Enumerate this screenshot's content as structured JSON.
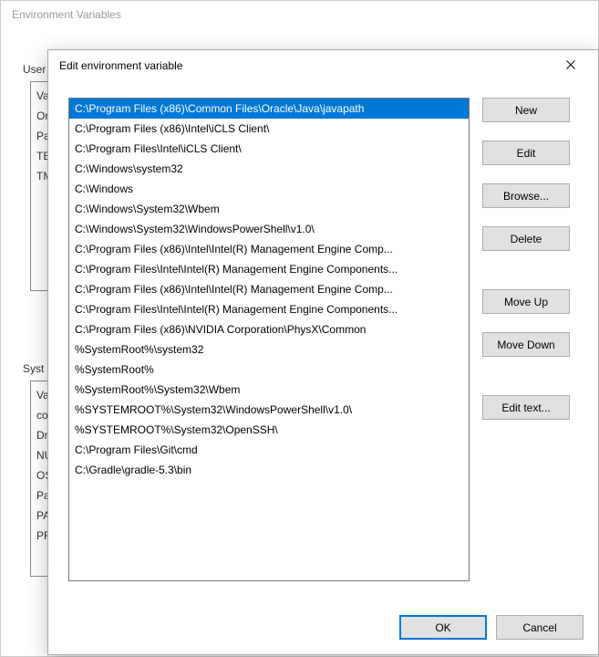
{
  "bg": {
    "title": "Environment Variables",
    "user_label": "User",
    "user_rows": [
      "Va",
      "On",
      "Pa",
      "TE",
      "TM"
    ],
    "sys_label": "Syst",
    "sys_rows": [
      "Va",
      "co",
      "Dr",
      "NU",
      "OS",
      "Pa",
      "PA",
      "PR"
    ]
  },
  "dialog": {
    "title": "Edit environment variable",
    "list": [
      "C:\\Program Files (x86)\\Common Files\\Oracle\\Java\\javapath",
      "C:\\Program Files (x86)\\Intel\\iCLS Client\\",
      "C:\\Program Files\\Intel\\iCLS Client\\",
      "C:\\Windows\\system32",
      "C:\\Windows",
      "C:\\Windows\\System32\\Wbem",
      "C:\\Windows\\System32\\WindowsPowerShell\\v1.0\\",
      "C:\\Program Files (x86)\\Intel\\Intel(R) Management Engine Comp...",
      "C:\\Program Files\\Intel\\Intel(R) Management Engine Components...",
      "C:\\Program Files (x86)\\Intel\\Intel(R) Management Engine Comp...",
      "C:\\Program Files\\Intel\\Intel(R) Management Engine Components...",
      "C:\\Program Files (x86)\\NVIDIA Corporation\\PhysX\\Common",
      "%SystemRoot%\\system32",
      "%SystemRoot%",
      "%SystemRoot%\\System32\\Wbem",
      "%SYSTEMROOT%\\System32\\WindowsPowerShell\\v1.0\\",
      "%SYSTEMROOT%\\System32\\OpenSSH\\",
      "C:\\Program Files\\Git\\cmd",
      "C:\\Gradle\\gradle-5.3\\bin"
    ],
    "selected_index": 0,
    "buttons": {
      "new": "New",
      "edit": "Edit",
      "browse": "Browse...",
      "delete": "Delete",
      "move_up": "Move Up",
      "move_down": "Move Down",
      "edit_text": "Edit text...",
      "ok": "OK",
      "cancel": "Cancel"
    }
  }
}
